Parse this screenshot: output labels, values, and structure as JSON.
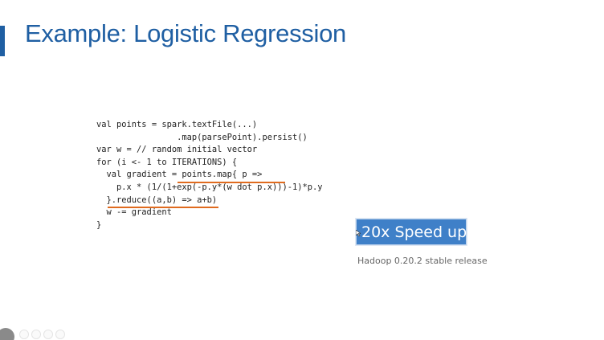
{
  "slide": {
    "title": "Example: Logistic Regression",
    "code_lines": [
      "val points = spark.textFile(...)",
      "                .map(parsePoint).persist()",
      "var w = // random initial vector",
      "for (i <- 1 to ITERATIONS) {",
      "  val gradient = points.map{ p =>",
      "    p.x * (1/(1+exp(-p.y*(w dot p.x)))-1)*p.y",
      "  }.reduce((a,b) => a+b)",
      "  w -= gradient",
      "}"
    ],
    "speedup_label": "20x Speed up",
    "caption": "Hadoop 0.20.2 stable release"
  },
  "colors": {
    "title": "#1f5fa3",
    "accent_bar": "#1f5fa3",
    "underline": "#e06b1f",
    "speedup_bg": "#3f80c8"
  },
  "icons": {
    "cursor": "mouse-pointer-icon",
    "controls": [
      "menu-icon",
      "previous-icon",
      "next-icon",
      "zoom-icon",
      "more-icon"
    ]
  }
}
